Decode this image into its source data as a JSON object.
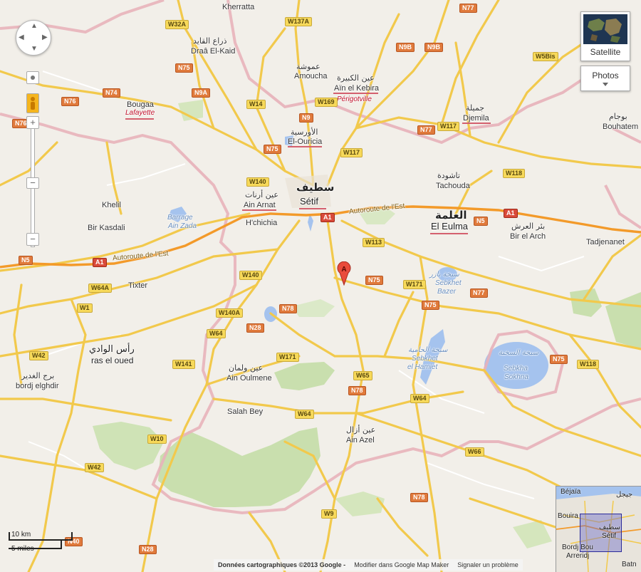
{
  "map": {
    "cities": [
      {
        "name": "Kherratta",
        "id": "kherratta"
      },
      {
        "name": "ذراع القايد",
        "id": "draa-ar"
      },
      {
        "name": "Draâ El-Kaid",
        "id": "draa"
      },
      {
        "name": "عموشة",
        "id": "amoucha-ar"
      },
      {
        "name": "Amoucha",
        "id": "amoucha"
      },
      {
        "name": "عين الكبيرة",
        "id": "ainkebira-ar"
      },
      {
        "name": "Aïn el Kebira",
        "id": "ainkebira"
      },
      {
        "name": "Périgotville",
        "id": "perigotville"
      },
      {
        "name": "Bougaa",
        "id": "bougaa"
      },
      {
        "name": "Lafayette",
        "id": "lafayette"
      },
      {
        "name": "الأورسية",
        "id": "ouricia-ar"
      },
      {
        "name": "El-Ouricia",
        "id": "ouricia"
      },
      {
        "name": "جميلة",
        "id": "djemila-ar"
      },
      {
        "name": "Djemila",
        "id": "djemila"
      },
      {
        "name": "بوجام",
        "id": "bouhatem-ar"
      },
      {
        "name": "Bouhatem",
        "id": "bouhatem"
      },
      {
        "name": "تاشودة",
        "id": "tachouda-ar"
      },
      {
        "name": "Tachouda",
        "id": "tachouda"
      },
      {
        "name": "سطيف",
        "id": "setif-ar"
      },
      {
        "name": "Sétif",
        "id": "setif"
      },
      {
        "name": "عين أرنات",
        "id": "ainarnat-ar"
      },
      {
        "name": "Ain Arnat",
        "id": "ainarnat"
      },
      {
        "name": "العلمة",
        "id": "eulma-ar"
      },
      {
        "name": "El Eulma",
        "id": "eulma"
      },
      {
        "name": "بئر العرش",
        "id": "birelarch-ar"
      },
      {
        "name": "Bir el Arch",
        "id": "birelarch"
      },
      {
        "name": "Tadjenanet",
        "id": "tadjenanet"
      },
      {
        "name": "Khelil",
        "id": "khelil"
      },
      {
        "name": "Bir Kasdali",
        "id": "birkasdali"
      },
      {
        "name": "H'chichia",
        "id": "hchichia"
      },
      {
        "name": "Tixter",
        "id": "tixter"
      },
      {
        "name": "رأس الوادي",
        "id": "rasoued-ar"
      },
      {
        "name": "ras el oued",
        "id": "rasoued"
      },
      {
        "name": "برج الغدير",
        "id": "bordj-ar"
      },
      {
        "name": "bordj elghdir",
        "id": "bordj"
      },
      {
        "name": "عين ولمان",
        "id": "oulmene-ar"
      },
      {
        "name": "Ain Oulmene",
        "id": "oulmene"
      },
      {
        "name": "Salah Bey",
        "id": "salahbey"
      },
      {
        "name": "عين أزال",
        "id": "ainazel-ar"
      },
      {
        "name": "Ain Azel",
        "id": "ainazel"
      }
    ],
    "water": [
      {
        "name": "Barrage",
        "id": "barrage"
      },
      {
        "name": "Ain Zada",
        "id": "ainzada"
      },
      {
        "name": "سبخة بازر",
        "id": "bazer-ar"
      },
      {
        "name": "Sebkhet",
        "id": "bazer1"
      },
      {
        "name": "Bazer",
        "id": "bazer2"
      },
      {
        "name": "سبخة الحامية",
        "id": "hamiet-ar"
      },
      {
        "name": "Sebkhet",
        "id": "hamiet1"
      },
      {
        "name": "el Hamiet",
        "id": "hamiet2"
      },
      {
        "name": "سبخة السخنة",
        "id": "sokhna-ar"
      },
      {
        "name": "Sebkha",
        "id": "sokhna1"
      },
      {
        "name": "Sokhna",
        "id": "sokhna2"
      }
    ],
    "highway_label": "Autoroute de l'Est",
    "roads": [
      "W32A",
      "W137A",
      "N77",
      "N9B",
      "N9B",
      "W5Bis",
      "N75",
      "N74",
      "N76",
      "N9A",
      "W14",
      "W169",
      "N9",
      "N77",
      "W117",
      "N76",
      "N75",
      "W117",
      "W118",
      "W140",
      "A1",
      "N5",
      "A1",
      "A1",
      "N5",
      "W113",
      "W140",
      "N75",
      "W171",
      "N77",
      "N75",
      "W64A",
      "W1",
      "W140A",
      "N78",
      "N28",
      "W64",
      "W171",
      "W42",
      "W141",
      "W65",
      "W118",
      "N75",
      "N78",
      "W64",
      "W10",
      "W64",
      "W66",
      "W42",
      "N78",
      "W9",
      "N40",
      "N28"
    ],
    "marker_label": "A"
  },
  "controls": {
    "zoom_in": "+",
    "zoom_out": "−",
    "satellite_label": "Satellite",
    "photos_label": "Photos"
  },
  "scale": {
    "km": "10 km",
    "miles": "5 miles"
  },
  "footer": {
    "copyright": "Données cartographiques ©2013 Google -",
    "edit": "Modifier dans Google Map Maker",
    "report": "Signaler un problème"
  },
  "overview": {
    "labels": [
      "Béjaïa",
      "جيجل",
      "Bouira",
      "سطيف",
      "Sétif",
      "Bordj Bou",
      "Arreridj",
      "Batn"
    ]
  },
  "colors": {
    "land": "#f2efe9",
    "highway": "#f39a2a",
    "major_road": "#f7d45a",
    "border": "#e6a6b0",
    "water": "#a5c3ee",
    "park": "#c9dfae"
  }
}
